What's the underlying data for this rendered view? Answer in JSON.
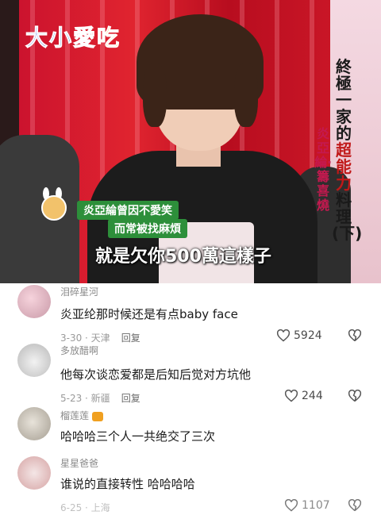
{
  "video": {
    "logo": [
      "大",
      "小",
      "愛",
      "吃"
    ],
    "title_vertical": "終極一家的",
    "title_highlight": "超能力",
    "title_rest": "料理(下)",
    "subtitle_vertical": "炎亞綸‧籌喜燒",
    "caption_line1": "炎亞綸曾因不愛笑",
    "caption_line2": "而常被找麻煩",
    "subtitle_text": "就是欠你500萬這樣子"
  },
  "comments": [
    {
      "username": "泪碎星河",
      "text": "炎亚纶那时候还是有点baby face",
      "date_location": "3-30 · 天津",
      "reply_label": "回复",
      "likes": "5924"
    },
    {
      "username": "多放醋啊",
      "text": "他每次谈恋爱都是后知后觉对方坑他",
      "date_location": "5-23 · 新疆",
      "reply_label": "回复",
      "likes": "244"
    },
    {
      "username": "榴莲莲",
      "text": "哈哈哈三个人一共绝交了三次",
      "date_location": "",
      "reply_label": "",
      "likes": ""
    },
    {
      "username": "星星爸爸",
      "text": "谁说的直接转性 哈哈哈哈",
      "date_location": "6-25 · 上海",
      "reply_label": "",
      "likes": "1107"
    }
  ],
  "colors": {
    "caption_green": "#2d8f3a",
    "username_gray": "#8a8a8a",
    "title_red": "#c01818"
  }
}
